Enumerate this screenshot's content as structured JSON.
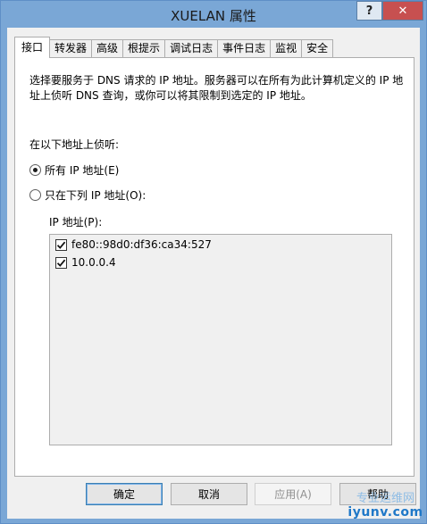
{
  "window": {
    "title": "XUELAN 属性",
    "help_glyph": "?",
    "close_glyph": "✕"
  },
  "tabs": [
    {
      "label": "接口",
      "active": true
    },
    {
      "label": "转发器",
      "active": false
    },
    {
      "label": "高级",
      "active": false
    },
    {
      "label": "根提示",
      "active": false
    },
    {
      "label": "调试日志",
      "active": false
    },
    {
      "label": "事件日志",
      "active": false
    },
    {
      "label": "监视",
      "active": false
    },
    {
      "label": "安全",
      "active": false
    }
  ],
  "panel": {
    "description": "选择要服务于 DNS 请求的 IP 地址。服务器可以在所有为此计算机定义的 IP 地址上侦听 DNS 查询，或你可以将其限制到选定的 IP 地址。",
    "listen_label": "在以下地址上侦听:",
    "radio_all": {
      "label": "所有 IP 地址(E)",
      "checked": true
    },
    "radio_only": {
      "label": "只在下列 IP 地址(O):",
      "checked": false
    },
    "ip_label": "IP 地址(P):",
    "ip_addresses": [
      {
        "address": "fe80::98d0:df36:ca34:527",
        "checked": true
      },
      {
        "address": "10.0.0.4",
        "checked": true
      }
    ]
  },
  "buttons": {
    "ok": "确定",
    "cancel": "取消",
    "apply": "应用(A)",
    "help": "帮助"
  },
  "watermark": {
    "top": "专业运维网",
    "bottom": "iyunv.com"
  }
}
